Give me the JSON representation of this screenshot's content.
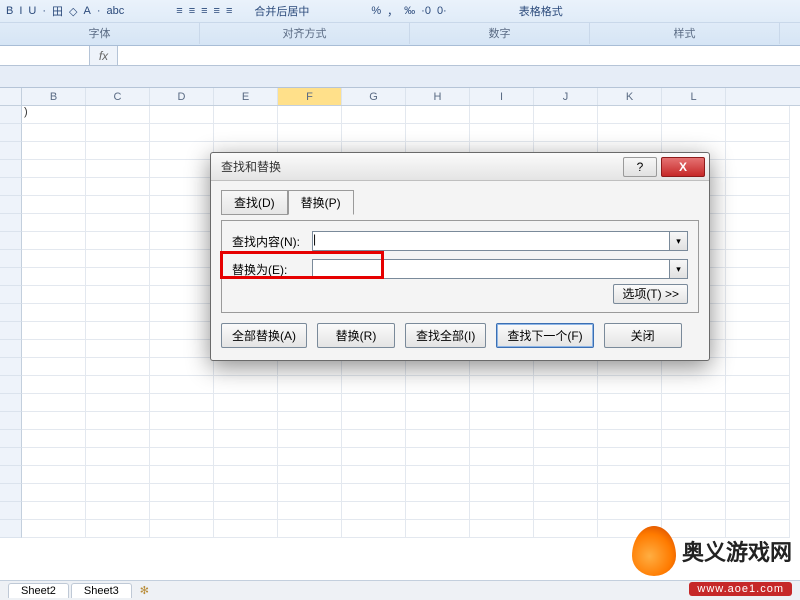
{
  "ribbon": {
    "icons": [
      "B",
      "I",
      "U",
      "·",
      "田",
      "◇",
      "A",
      "·",
      "abc",
      "",
      "≡",
      "≡",
      "≡",
      "≡",
      "≡",
      "",
      "合并后居中",
      "",
      "%",
      "，",
      "‰",
      "·0",
      "0·",
      "",
      "表格格式"
    ],
    "groups": {
      "font": "字体",
      "align": "对齐方式",
      "number": "数字",
      "style": "样式"
    }
  },
  "fbar": {
    "fx": "fx"
  },
  "columns": [
    "B",
    "C",
    "D",
    "E",
    "F",
    "G",
    "H",
    "I",
    "J",
    "K",
    "L"
  ],
  "active_col": "F",
  "first_col_value": ")",
  "dialog": {
    "title": "查找和替换",
    "help_symbol": "?",
    "close_symbol": "X",
    "tabs": {
      "find": "查找(D)",
      "replace": "替换(P)"
    },
    "find_label": "查找内容(N):",
    "replace_label": "替换为(E):",
    "find_value": "|",
    "replace_value": "",
    "options": "选项(T) >>",
    "buttons": {
      "replace_all": "全部替换(A)",
      "replace": "替换(R)",
      "find_all": "查找全部(I)",
      "find_next": "查找下一个(F)",
      "close": "关闭"
    }
  },
  "sheets": {
    "s2": "Sheet2",
    "s3": "Sheet3"
  },
  "watermark": {
    "text": "奥义游戏网",
    "url": "www.aoe1.com"
  }
}
